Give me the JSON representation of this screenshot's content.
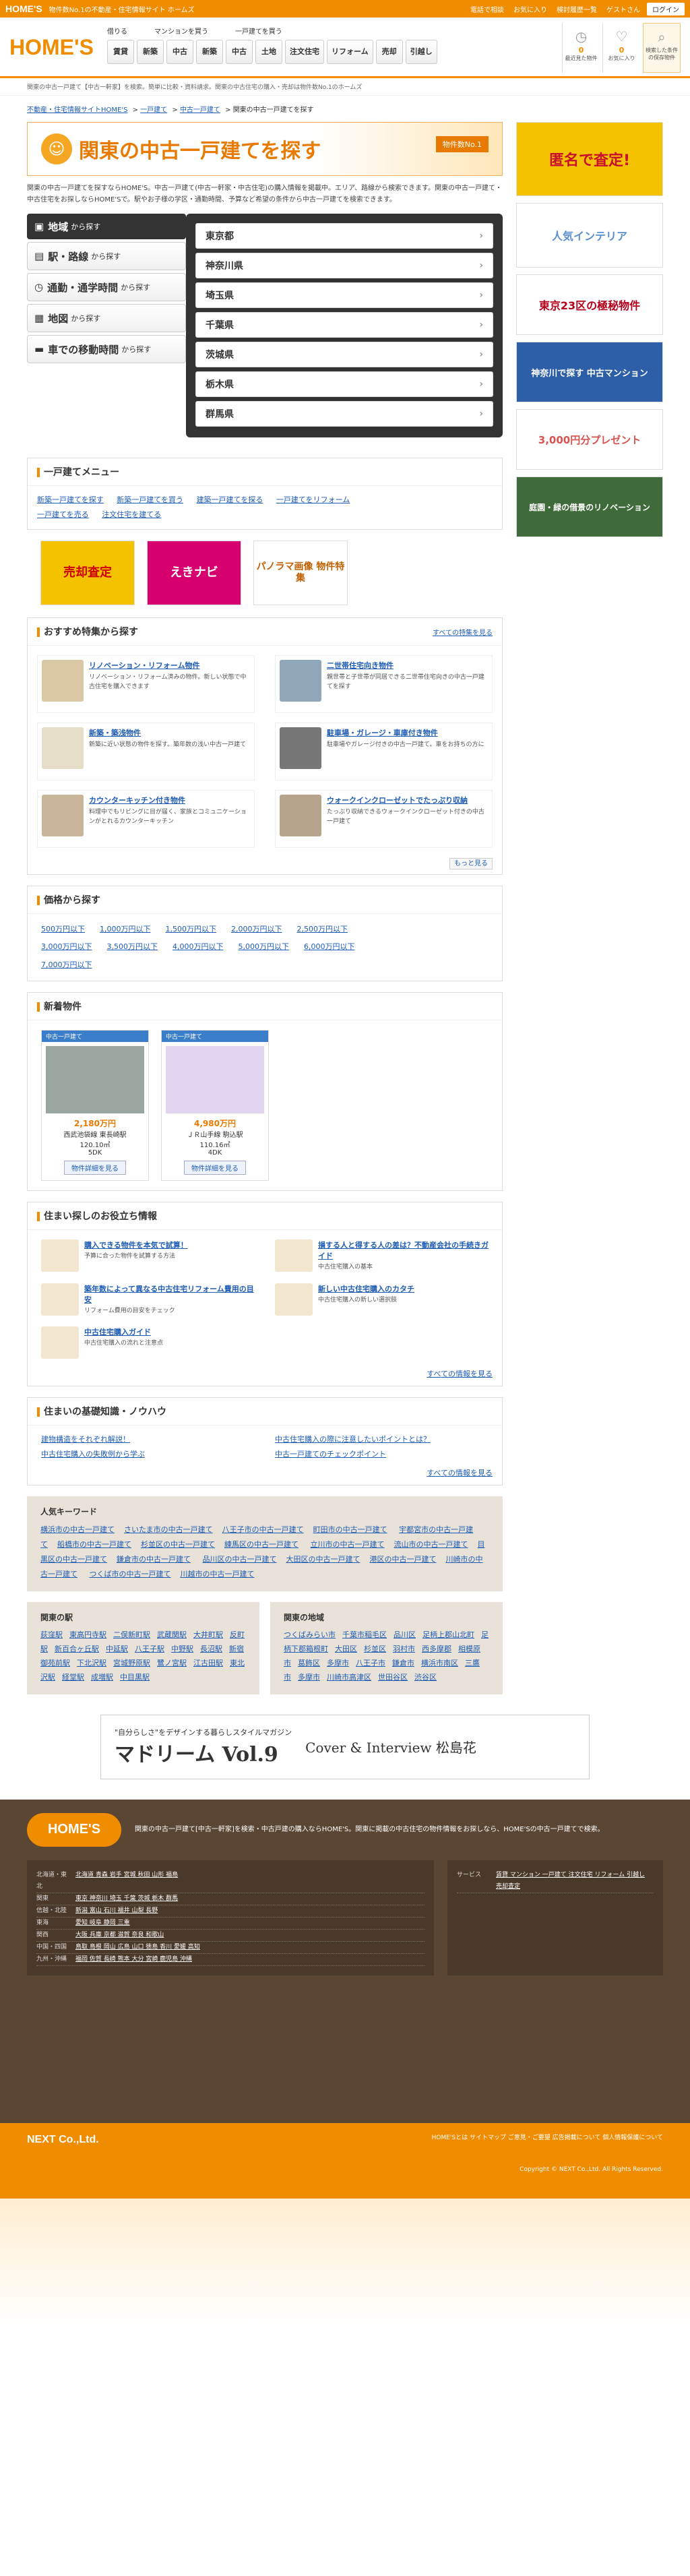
{
  "topbar": {
    "brand": "HOME'S",
    "desc": "物件数No.1の不動産・住宅情報サイト ホームズ",
    "links": [
      "電話で相談",
      "お気に入り",
      "検討履歴一覧",
      "ゲストさん"
    ],
    "login": "ログイン"
  },
  "header": {
    "logo": "HOME'S",
    "nav_labels": [
      "借りる",
      "マンションを買う",
      "一戸建てを買う"
    ],
    "nav_buttons": [
      "賃貸",
      "新築",
      "中古",
      "新築",
      "中古",
      "土地",
      "注文住宅",
      "リフォーム",
      "売却",
      "引越し"
    ],
    "history": [
      {
        "label": "最近見た物件",
        "num": "0"
      },
      {
        "label": "お気に入り",
        "num": "0"
      },
      {
        "label": "検索した条件の保存物件",
        "num": ""
      }
    ]
  },
  "subbar": "関東の中古一戸建て【中古一軒家】を検索。簡単に比較・資料請求。関東の中古住宅の購入・売却は物件数No.1のホームズ",
  "breadcrumb": [
    "不動産・住宅情報サイトHOME'S",
    "一戸建て",
    "中古一戸建て",
    "関東の中古一戸建てを探す"
  ],
  "title": {
    "main": "関東の中古一戸建てを探す",
    "badge": "物件数No.1"
  },
  "intro": "関東の中古一戸建てを探すならHOME'S。中古一戸建て(中古一軒家・中古住宅)の購入情報を掲載中。エリア、路線から検索できます。関東の中古一戸建て・中古住宅をお探しならHOME'Sで。駅やお子様の学区・通勤時間、予算など希望の条件から中古一戸建てを検索できます。",
  "search_tabs": [
    {
      "label": "地域",
      "sub": "から探す",
      "icon": "map-pin"
    },
    {
      "label": "駅・路線",
      "sub": "から探す",
      "icon": "train"
    },
    {
      "label": "通勤・通学時間",
      "sub": "から探す",
      "icon": "clock"
    },
    {
      "label": "地図",
      "sub": "から探す",
      "icon": "map"
    },
    {
      "label": "車での移動時間",
      "sub": "から探す",
      "icon": "car"
    }
  ],
  "prefectures": [
    "東京都",
    "神奈川県",
    "埼玉県",
    "千葉県",
    "茨城県",
    "栃木県",
    "群馬県"
  ],
  "menu": {
    "title": "一戸建てメニュー",
    "links": [
      "新築一戸建てを探す",
      "新築一戸建てを買う",
      "建築一戸建てを探る",
      "一戸建てをリフォーム",
      "一戸建てを売る",
      "注文住宅を建てる"
    ]
  },
  "banners": [
    {
      "label": "売却査定"
    },
    {
      "label": "えきナビ"
    },
    {
      "label": "パノラマ画像 物件特集"
    }
  ],
  "recommend": {
    "title": "おすすめ特集から探す",
    "more": "すべての特集を見る",
    "items": [
      {
        "title": "リノベーション・リフォーム物件",
        "desc": "リノベーション・リフォーム済みの物件。新しい状態で中古住宅を購入できます"
      },
      {
        "title": "二世帯住宅向き物件",
        "desc": "親世帯と子世帯が同居できる二世帯住宅向きの中古一戸建てを探す"
      },
      {
        "title": "新築・築浅物件",
        "desc": "新築に近い状態の物件を探す。築年数の浅い中古一戸建て"
      },
      {
        "title": "駐車場・ガレージ・車庫付き物件",
        "desc": "駐車場やガレージ付きの中古一戸建て。車をお持ちの方に"
      },
      {
        "title": "カウンターキッチン付き物件",
        "desc": "料理中でもリビングに目が届く、家族とコミュニケーションがとれるカウンターキッチン"
      },
      {
        "title": "ウォークインクローゼットでたっぷり収納",
        "desc": "たっぷり収納できるウォークインクローゼット付きの中古一戸建て"
      }
    ],
    "more2": "もっと見る"
  },
  "prices": {
    "title": "価格から探す",
    "items": [
      "500万円以下",
      "1,000万円以下",
      "1,500万円以下",
      "2,000万円以下",
      "2,500万円以下",
      "3,000万円以下",
      "3,500万円以下",
      "4,000万円以下",
      "5,000万円以下",
      "6,000万円以下",
      "7,000万円以下"
    ]
  },
  "newprops": {
    "title": "新着物件",
    "items": [
      {
        "tag": "中古一戸建て",
        "price": "2,180万円",
        "loc": "西武池袋線 東長崎駅",
        "area": "120.10㎡",
        "layout": "5DK",
        "btn": "物件詳細を見る"
      },
      {
        "tag": "中古一戸建て",
        "price": "4,980万円",
        "loc": "ＪＲ山手線 駒込駅",
        "area": "110.16㎡",
        "layout": "4DK",
        "btn": "物件詳細を見る"
      }
    ]
  },
  "help": {
    "title": "住まい探しのお役立ち情報",
    "more": "すべての情報を見る",
    "items": [
      {
        "title": "購入できる物件を本気で試算！",
        "desc": "予算に合った物件を試算する方法"
      },
      {
        "title": "損する人と得する人の差は？不動産会社の手続きガイド",
        "desc": "中古住宅購入の基本"
      },
      {
        "title": "築年数によって異なる中古住宅リフォーム費用の目安",
        "desc": "リフォーム費用の目安をチェック"
      },
      {
        "title": "新しい中古住宅購入のカタチ",
        "desc": "中古住宅購入の新しい選択肢"
      },
      {
        "title": "中古住宅購入ガイド",
        "desc": "中古住宅購入の流れと注意点"
      }
    ]
  },
  "knowledge": {
    "title": "住まいの基礎知識・ノウハウ",
    "more": "すべての情報を見る",
    "items": [
      "建物構造をそれぞれ解説！",
      "中古住宅購入の際に注意したいポイントとは？",
      "中古住宅購入の失敗例から学ぶ",
      "中古一戸建てのチェックポイント"
    ]
  },
  "keywords": {
    "title": "人気キーワード",
    "items": [
      "横浜市の中古一戸建て",
      "さいたま市の中古一戸建て",
      "八王子市の中古一戸建て",
      "町田市の中古一戸建て",
      "宇都宮市の中古一戸建て",
      "船橋市の中古一戸建て",
      "杉並区の中古一戸建て",
      "練馬区の中古一戸建て",
      "立川市の中古一戸建て",
      "流山市の中古一戸建て",
      "目黒区の中古一戸建て",
      "鎌倉市の中古一戸建て",
      "品川区の中古一戸建て",
      "大田区の中古一戸建て",
      "港区の中古一戸建て",
      "川崎市の中古一戸建て",
      "つくば市の中古一戸建て",
      "川越市の中古一戸建て"
    ]
  },
  "stations": {
    "title": "関東の駅",
    "items": [
      "荻窪駅",
      "東高円寺駅",
      "二俣新町駅",
      "武蔵関駅",
      "大井町駅",
      "反町駅",
      "新百合ヶ丘駅",
      "中延駅",
      "八王子駅",
      "中野駅",
      "長沼駅",
      "新宿御苑前駅",
      "下北沢駅",
      "宮城野原駅",
      "鷺ノ宮駅",
      "江古田駅",
      "東北沢駅",
      "経堂駅",
      "成増駅",
      "中目黒駅"
    ]
  },
  "areas": {
    "title": "関東の地域",
    "items": [
      "つくばみらい市",
      "千葉市稲毛区",
      "品川区",
      "足柄上郡山北町",
      "足柄下郡箱根町",
      "大田区",
      "杉並区",
      "羽村市",
      "西多摩郡",
      "相模原市",
      "葛飾区",
      "多摩市",
      "八王子市",
      "鎌倉市",
      "横浜市南区",
      "三鷹市",
      "多摩市",
      "川崎市高津区",
      "世田谷区",
      "渋谷区"
    ]
  },
  "ad": {
    "sub": "\"自分らしさ\"をデザインする暮らしスタイルマガジン",
    "title": "マドリーム Vol.9",
    "right": "Cover & Interview 松島花"
  },
  "side": [
    {
      "label": "匿名で査定!",
      "color": "#c8102e",
      "h": 110
    },
    {
      "label": "人気インテリア",
      "color": "#5a8fcf",
      "h": 96
    },
    {
      "label": "東京23区の極秘物件",
      "color": "#b3001b",
      "h": 90
    },
    {
      "label": "神奈川で探す 中古マンション",
      "color": "#2d5ea8",
      "h": 90
    },
    {
      "label": "3,000円分プレゼント",
      "color": "#d9534f",
      "h": 90
    },
    {
      "label": "庭園・緑の借景のリノベーション",
      "color": "#3f6b3a",
      "h": 90
    }
  ],
  "footer": {
    "logo": "HOME'S",
    "desc": "関東の中古一戸建て[中古一軒家]を検索・中古戸建の購入ならHOME'S。関東に掲載の中古住宅の物件情報をお探しなら、HOME'Sの中古一戸建てで検索。",
    "regions": [
      {
        "name": "北海道・東北",
        "list": "北海道 青森 岩手 宮城 秋田 山形 福島"
      },
      {
        "name": "関東",
        "list": "東京 神奈川 埼玉 千葉 茨城 栃木 群馬"
      },
      {
        "name": "信越・北陸",
        "list": "新潟 富山 石川 福井 山梨 長野"
      },
      {
        "name": "東海",
        "list": "愛知 岐阜 静岡 三重"
      },
      {
        "name": "関西",
        "list": "大阪 兵庫 京都 滋賀 奈良 和歌山"
      },
      {
        "name": "中国・四国",
        "list": "鳥取 島根 岡山 広島 山口 徳島 香川 愛媛 高知"
      },
      {
        "name": "九州・沖縄",
        "list": "福岡 佐賀 長崎 熊本 大分 宮崎 鹿児島 沖縄"
      }
    ],
    "services_title": "サービス",
    "services": "賃貸 マンション 一戸建て 注文住宅 リフォーム 引越し 売却査定",
    "company": "NEXT Co.,Ltd.",
    "links": "HOME'Sとは サイトマップ ご意見・ご要望 広告掲載について 個人情報保護について",
    "copy": "Copyright © NEXT Co.,Ltd. All Rights Reserved."
  }
}
